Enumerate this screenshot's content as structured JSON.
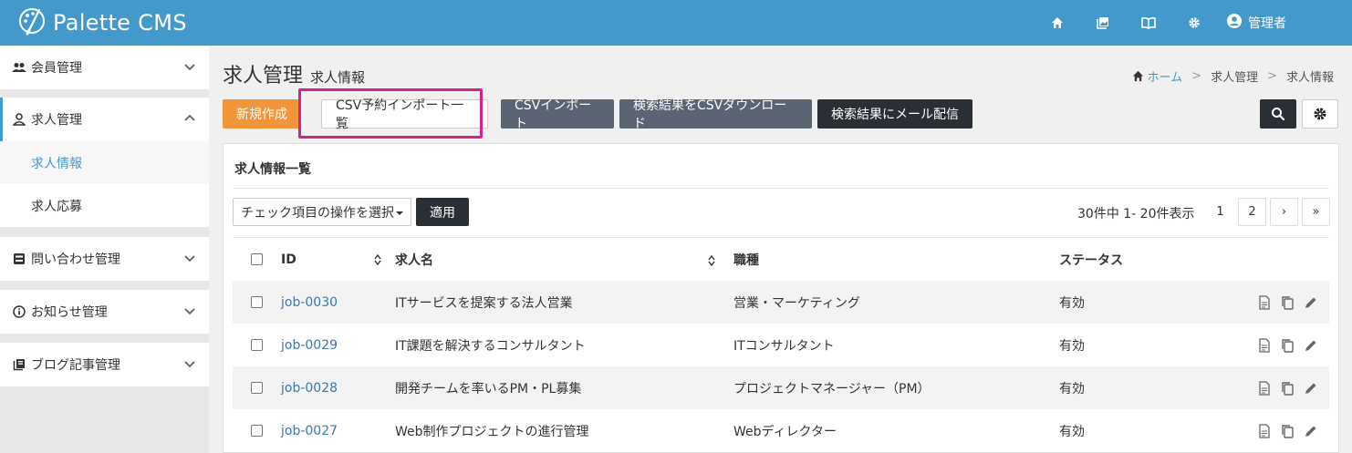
{
  "header": {
    "app_name": "Palette CMS",
    "icons": [
      "home-icon",
      "media-icon",
      "book-icon",
      "gear-icon"
    ],
    "user_label": "管理者"
  },
  "sidebar": {
    "items": [
      {
        "label": "会員管理",
        "icon": "people-icon"
      },
      {
        "label": "求人管理",
        "icon": "person-icon"
      },
      {
        "label": "問い合わせ管理",
        "icon": "inbox-icon"
      },
      {
        "label": "お知らせ管理",
        "icon": "info-icon"
      },
      {
        "label": "ブログ記事管理",
        "icon": "library-icon"
      }
    ],
    "subitems": [
      {
        "label": "求人情報"
      },
      {
        "label": "求人応募"
      }
    ]
  },
  "page": {
    "title": "求人管理",
    "subtitle": "求人情報"
  },
  "breadcrumb": {
    "home": "ホーム",
    "level1": "求人管理",
    "level2": "求人情報"
  },
  "toolbar": {
    "new_label": "新規作成",
    "csv_reserved_label": "CSV予約インポート一覧",
    "csv_import_label": "CSVインポート",
    "csv_download_label": "検索結果をCSVダウンロード",
    "mail_label": "検索結果にメール配信"
  },
  "list": {
    "title": "求人情報一覧",
    "bulk_select": "チェック項目の操作を選択",
    "apply_label": "適用",
    "count_text": "30件中 1- 20件表示",
    "pages": [
      "1",
      "2",
      "›",
      "»"
    ],
    "columns": {
      "id": "ID",
      "name": "求人名",
      "category": "職種",
      "status": "ステータス"
    },
    "rows": [
      {
        "id": "job-0030",
        "name": "ITサービスを提案する法人営業",
        "category": "営業・マーケティング",
        "status": "有効"
      },
      {
        "id": "job-0029",
        "name": "IT課題を解決するコンサルタント",
        "category": "ITコンサルタント",
        "status": "有効"
      },
      {
        "id": "job-0028",
        "name": "開発チームを率いるPM・PL募集",
        "category": "プロジェクトマネージャー（PM）",
        "status": "有効"
      },
      {
        "id": "job-0027",
        "name": "Web制作プロジェクトの進行管理",
        "category": "Webディレクター",
        "status": "有効"
      }
    ]
  },
  "colors": {
    "header_bg": "#4499cc",
    "accent_orange": "#f0953a",
    "highlight": "#d3238c",
    "link": "#3a78b0"
  }
}
